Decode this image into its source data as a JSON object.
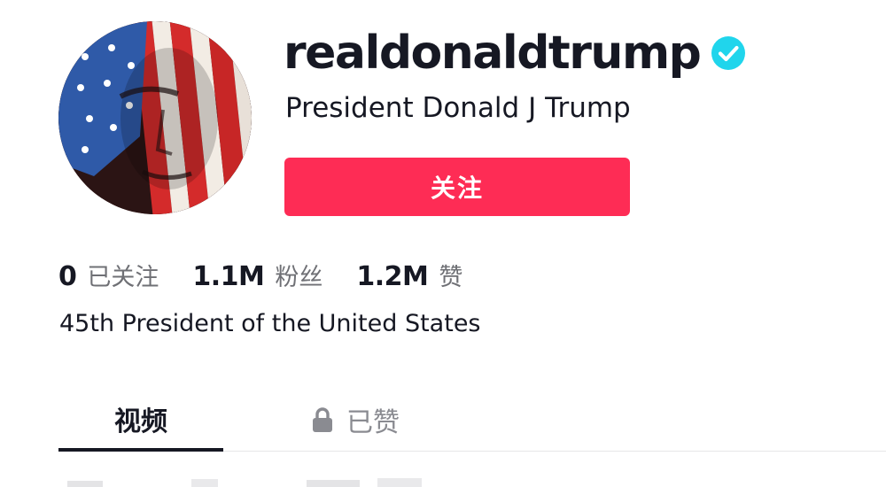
{
  "profile": {
    "username": "realdonaldtrump",
    "verified": true,
    "display_name": "President Donald J Trump",
    "follow_label": "关注",
    "bio": "45th President of the United States"
  },
  "stats": [
    {
      "value": "0",
      "label": "已关注"
    },
    {
      "value": "1.1M",
      "label": "粉丝"
    },
    {
      "value": "1.2M",
      "label": "赞"
    }
  ],
  "tabs": [
    {
      "label": "视频",
      "active": true
    },
    {
      "label": "已赞",
      "active": false,
      "locked": true
    }
  ],
  "colors": {
    "accent": "#fe2c55",
    "verified": "#20d5ec",
    "text_primary": "#161823",
    "text_secondary": "#6f7075"
  },
  "icons": {
    "verified": "verified-badge-icon",
    "lock": "lock-icon"
  }
}
